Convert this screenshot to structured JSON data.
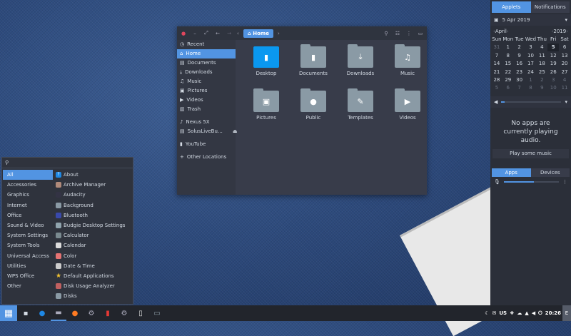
{
  "file_manager": {
    "path": "Home",
    "sidebar": [
      {
        "icon": "clock-icon",
        "g": "◷",
        "label": "Recent"
      },
      {
        "icon": "home-icon",
        "g": "⌂",
        "label": "Home",
        "active": true
      },
      {
        "icon": "document-icon",
        "g": "▤",
        "label": "Documents"
      },
      {
        "icon": "download-icon",
        "g": "⤓",
        "label": "Downloads"
      },
      {
        "icon": "music-icon",
        "g": "♫",
        "label": "Music"
      },
      {
        "icon": "picture-icon",
        "g": "▣",
        "label": "Pictures"
      },
      {
        "icon": "video-icon",
        "g": "▶",
        "label": "Videos"
      },
      {
        "icon": "trash-icon",
        "g": "▥",
        "label": "Trash"
      },
      {
        "icon": "phone-icon",
        "g": "♪",
        "label": "Nexus 5X",
        "gap": true
      },
      {
        "icon": "drive-icon",
        "g": "▤",
        "label": "SolusLiveBu…",
        "eject": true
      },
      {
        "icon": "folder-icon",
        "g": "▮",
        "label": "YouTube",
        "gap": true
      },
      {
        "icon": "plus-icon",
        "g": "+",
        "label": "Other Locations",
        "gap": true
      }
    ],
    "folders": [
      {
        "label": "Desktop",
        "g": "▮",
        "sel": true
      },
      {
        "label": "Documents",
        "g": "▮"
      },
      {
        "label": "Downloads",
        "g": "⤓"
      },
      {
        "label": "Music",
        "g": "♫"
      },
      {
        "label": "Pictures",
        "g": "▣"
      },
      {
        "label": "Public",
        "g": "●"
      },
      {
        "label": "Templates",
        "g": "✎"
      },
      {
        "label": "Videos",
        "g": "▶"
      }
    ]
  },
  "menu": {
    "categories": [
      "All",
      "Accessories",
      "Graphics",
      "Internet",
      "Office",
      "Sound & Video",
      "System Settings",
      "System Tools",
      "Universal Access",
      "Utilities",
      "WPS Office",
      "Other"
    ],
    "apps": [
      {
        "label": "About",
        "c": "#1e88e5",
        "g": "?"
      },
      {
        "label": "Archive Manager",
        "c": "#b08a7a"
      },
      {
        "label": "Audacity",
        "c": "#334"
      },
      {
        "label": "Background",
        "c": "#8a9aa5"
      },
      {
        "label": "Bluetooth",
        "c": "#3949ab"
      },
      {
        "label": "Budgie Desktop Settings",
        "c": "#90a4ae"
      },
      {
        "label": "Calculator",
        "c": "#7a8a90"
      },
      {
        "label": "Calendar",
        "c": "#ddd"
      },
      {
        "label": "Color",
        "c": "#e57373"
      },
      {
        "label": "Date & Time",
        "c": "#ccc"
      },
      {
        "label": "Default Applications",
        "c": "#f4c430",
        "g": "★"
      },
      {
        "label": "Disk Usage Analyzer",
        "c": "#c06060"
      },
      {
        "label": "Disks",
        "c": "#8a9aa5"
      }
    ]
  },
  "taskbar": {
    "clock": "20:26",
    "keyboard": "US"
  },
  "raven": {
    "tabs": [
      "Applets",
      "Notifications"
    ],
    "date": "5 Apr 2019",
    "month": "April",
    "year": "2019",
    "weekdays": [
      "Sun",
      "Mon",
      "Tue",
      "Wed",
      "Thu",
      "Fri",
      "Sat"
    ],
    "days": [
      "31",
      "1",
      "2",
      "3",
      "4",
      "5",
      "6",
      "7",
      "8",
      "9",
      "10",
      "11",
      "12",
      "13",
      "14",
      "15",
      "16",
      "17",
      "18",
      "19",
      "20",
      "21",
      "22",
      "23",
      "24",
      "25",
      "26",
      "27",
      "28",
      "29",
      "30",
      "1",
      "2",
      "3",
      "4",
      "5",
      "6",
      "7",
      "8",
      "9",
      "10",
      "11"
    ],
    "no_audio": "No apps are currently playing audio.",
    "play_button": "Play some music",
    "sound_tabs": [
      "Apps",
      "Devices"
    ],
    "mic_volume": 0.55
  },
  "colors": {
    "accent": "#5294e2"
  }
}
